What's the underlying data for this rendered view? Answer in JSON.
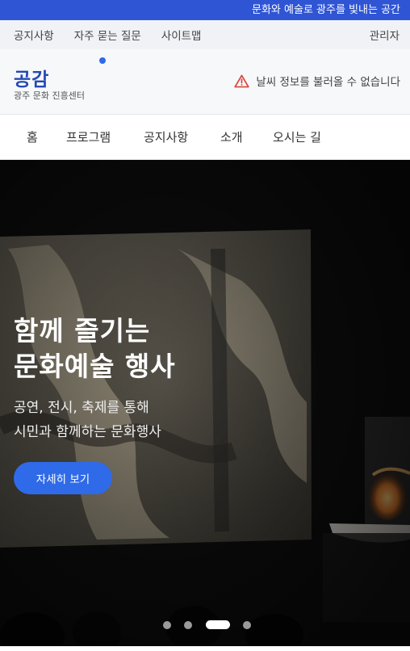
{
  "announcement": "문화와 예술로 광주를 빛내는 공간",
  "utility": {
    "links": [
      "공지사항",
      "자주 묻는 질문",
      "사이트맵"
    ],
    "admin": "관리자"
  },
  "brand": {
    "title": "공감",
    "subtitle": "광주 문화 진흥센터"
  },
  "weather": {
    "icon": "warning-triangle-icon",
    "message": "날씨 정보를 불러올 수 없습니다",
    "color": "#d9453b"
  },
  "nav": {
    "items": [
      "홈",
      "프로그램",
      "공지사항",
      "소개",
      "오시는 길"
    ]
  },
  "hero": {
    "title_line1": "함께 즐기는",
    "title_line2": "문화예술 행사",
    "desc_line1": "공연, 전시, 축제를 통해",
    "desc_line2": "시민과 함께하는 문화행사",
    "button": "자세히 보기",
    "slide_count": 4,
    "active_slide": 3
  },
  "colors": {
    "accent": "#2f6ae8",
    "announce_bg": "#2f55d4",
    "brand_text": "#2349b5"
  }
}
